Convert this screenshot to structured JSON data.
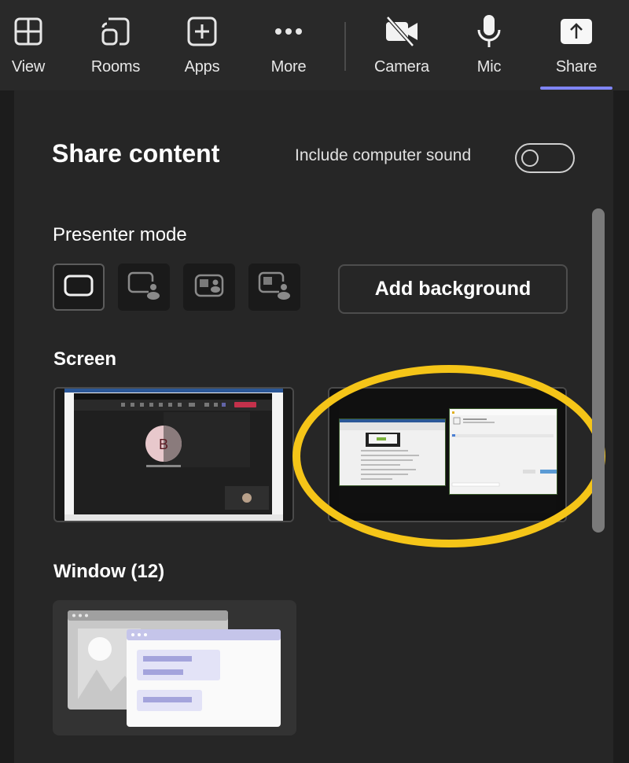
{
  "toolbar": {
    "items": [
      {
        "label": "View",
        "icon": "grid-view-icon"
      },
      {
        "label": "Rooms",
        "icon": "breakout-rooms-icon"
      },
      {
        "label": "Apps",
        "icon": "add-app-icon"
      },
      {
        "label": "More",
        "icon": "more-dots-icon"
      },
      {
        "label": "Camera",
        "icon": "camera-off-icon"
      },
      {
        "label": "Mic",
        "icon": "microphone-icon"
      },
      {
        "label": "Share",
        "icon": "share-screen-icon"
      }
    ],
    "active_item": "Share",
    "accent_color": "#7f85f5"
  },
  "panel": {
    "title": "Share content",
    "include_sound": {
      "label": "Include computer sound",
      "enabled": false
    },
    "presenter_mode": {
      "heading": "Presenter mode",
      "options": [
        {
          "name": "content-only",
          "selected": true
        },
        {
          "name": "standout",
          "selected": false
        },
        {
          "name": "side-by-side",
          "selected": false
        },
        {
          "name": "reporter",
          "selected": false
        }
      ],
      "add_background_label": "Add background"
    },
    "screen": {
      "heading": "Screen",
      "items": [
        {
          "name": "screen-1",
          "avatar_initial": "B"
        },
        {
          "name": "screen-2",
          "highlighted": true
        }
      ],
      "highlight_color": "#f5c518"
    },
    "window": {
      "heading": "Window (12)"
    }
  }
}
